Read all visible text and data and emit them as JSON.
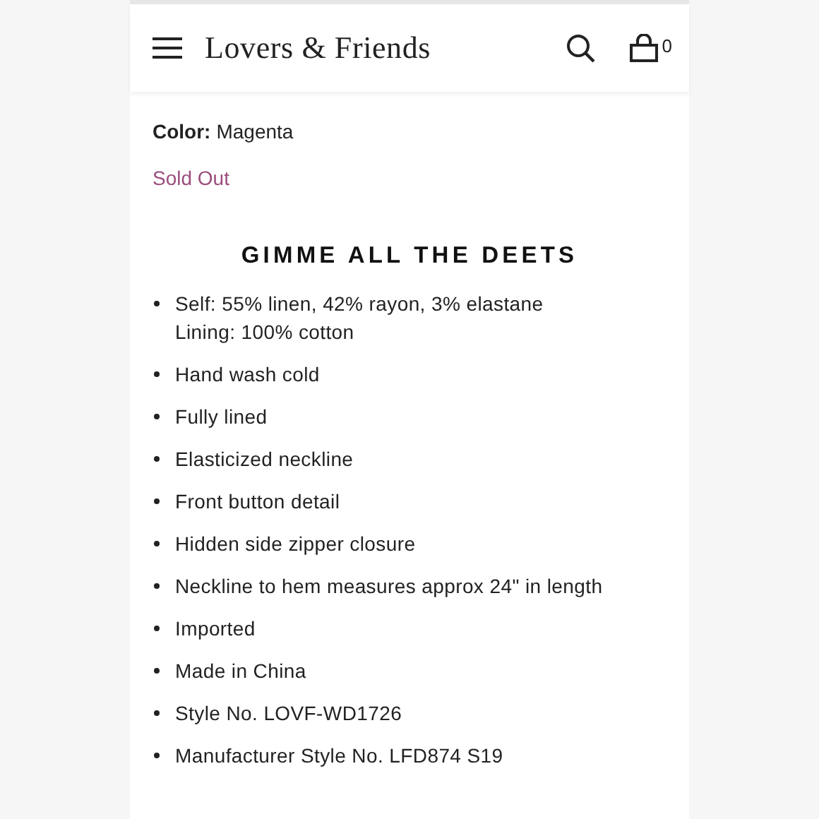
{
  "header": {
    "brand": "Lovers & Friends",
    "cart_count": "0"
  },
  "product": {
    "color_label": "Color:",
    "color_value": "Magenta",
    "availability": "Sold Out"
  },
  "details": {
    "title": "GIMME ALL THE DEETS",
    "items": [
      "Self: 55% linen, 42% rayon, 3% elastane\nLining: 100% cotton",
      "Hand wash cold",
      "Fully lined",
      "Elasticized neckline",
      "Front button detail",
      "Hidden side zipper closure",
      "Neckline to hem measures approx 24\" in length",
      "Imported",
      "Made in China",
      "Style No. LOVF-WD1726",
      "Manufacturer Style No. LFD874 S19"
    ]
  }
}
